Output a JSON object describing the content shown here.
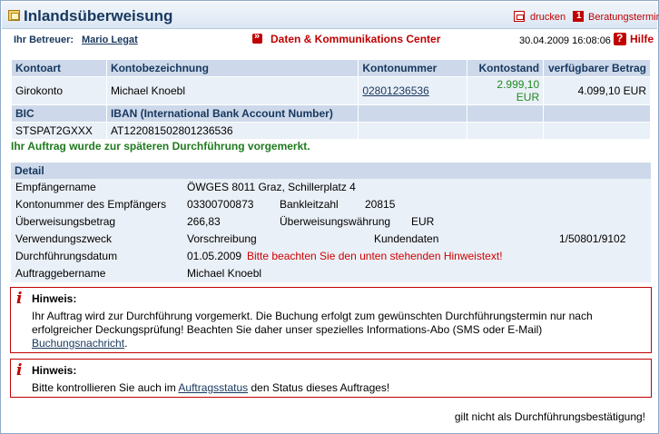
{
  "header": {
    "title": "Inlandsüberweisung",
    "print_label": "drucken",
    "appointment_label": "Beratungstermin"
  },
  "subheader": {
    "advisor_label": "Ihr Betreuer:",
    "advisor_name": "Mario Legat",
    "dkc_label": "Daten & Kommunikations Center",
    "datetime": "30.04.2009 16:08:06",
    "help_label": "Hilfe"
  },
  "account_table": {
    "headers": [
      "Kontoart",
      "Kontobezeichnung",
      "Kontonummer",
      "Kontostand",
      "verfügbarer Betrag"
    ],
    "row": [
      "Girokonto",
      "Michael Knoebl",
      "02801236536",
      "2.999,10 EUR",
      "4.099,10 EUR"
    ],
    "headers2": [
      "BIC",
      "IBAN (International Bank Account Number)"
    ],
    "row2": [
      "STSPAT2GXXX",
      "AT122081502801236536"
    ]
  },
  "notice": "Ihr Auftrag wurde zur späteren Durchführung vorgemerkt.",
  "detail": {
    "title": "Detail",
    "recipient_label": "Empfängername",
    "recipient_value": "ÖWGES 8011 Graz, Schillerplatz 4",
    "recipient_account_label": "Kontonummer des Empfängers",
    "recipient_account_value": "03300700873",
    "bank_code_label": "Bankleitzahl",
    "bank_code_value": "20815",
    "amount_label": "Überweisungsbetrag",
    "amount_value": "266,83",
    "currency_label": "Überweisungswährung",
    "currency_value": "EUR",
    "purpose_label": "Verwendungszweck",
    "purpose_value": "Vorschreibung",
    "customer_data_label": "Kundendaten",
    "customer_data_value": "1/50801/9102",
    "execution_date_label": "Durchführungsdatum",
    "execution_date_value": "01.05.2009",
    "execution_date_warning": "Bitte beachten Sie den unten stehenden Hinweistext!",
    "orderer_label": "Auftraggebername",
    "orderer_value": "Michael Knoebl"
  },
  "hint1": {
    "title": "Hinweis:",
    "text": "Ihr Auftrag wird zur Durchführung vorgemerkt. Die Buchung erfolgt zum gewünschten Durchführungstermin nur nach erfolgreicher Deckungsprüfung! Beachten Sie daher unser spezielles Informations-Abo (SMS oder E-Mail)",
    "link": "Buchungsnachricht",
    "suffix": "."
  },
  "hint2": {
    "title": "Hinweis:",
    "text_before": "Bitte kontrollieren Sie auch im",
    "link": "Auftragsstatus",
    "text_after": "den Status dieses Auftrages!"
  },
  "footer_note": "gilt nicht als Durchführungsbestätigung!"
}
